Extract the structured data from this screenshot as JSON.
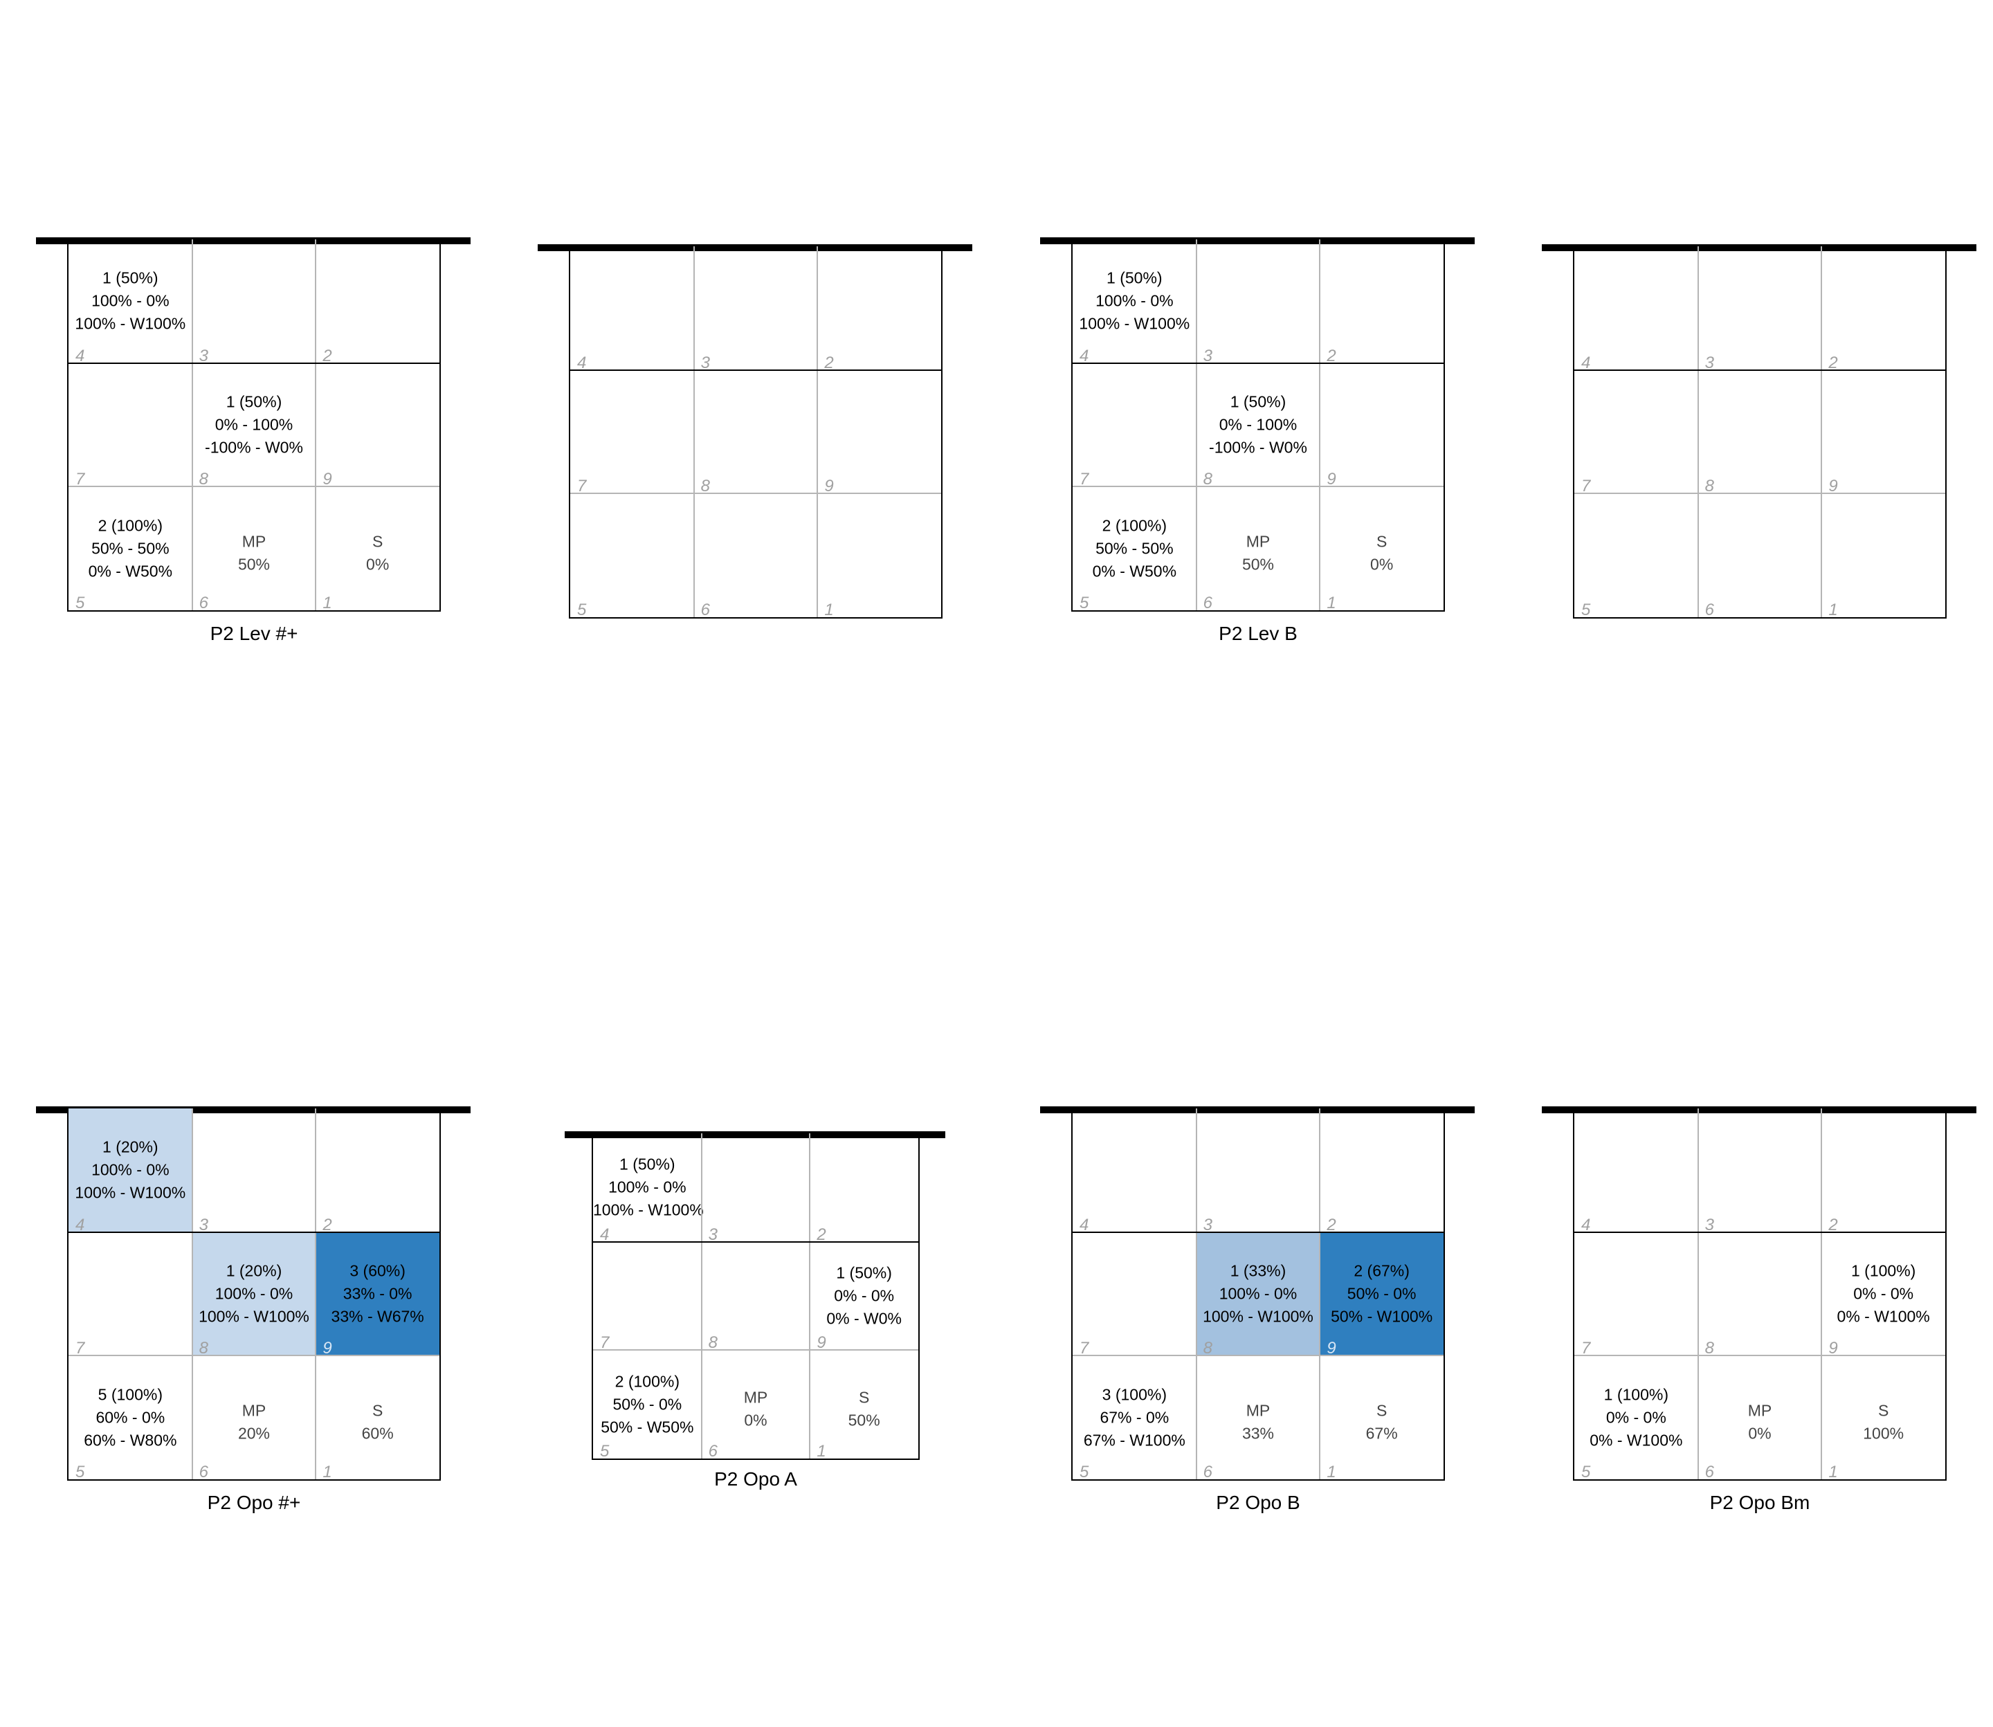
{
  "chart_data": [
    {
      "type": "table",
      "title": "P2 Lev #+",
      "cells": {
        "4": [
          "1 (50%)",
          "100% - 0%",
          "100% - W100%"
        ],
        "8": [
          "1 (50%)",
          "0% - 100%",
          "-100% - W0%"
        ],
        "5": [
          "2 (100%)",
          "50% - 50%",
          "0% - W50%"
        ],
        "6": [
          "MP",
          "50%"
        ],
        "1": [
          "S",
          "0%"
        ]
      },
      "highlights": {}
    },
    {
      "type": "table",
      "title": "",
      "cells": {},
      "highlights": {}
    },
    {
      "type": "table",
      "title": "P2 Lev B",
      "cells": {
        "4": [
          "1 (50%)",
          "100% - 0%",
          "100% - W100%"
        ],
        "8": [
          "1 (50%)",
          "0% - 100%",
          "-100% - W0%"
        ],
        "5": [
          "2 (100%)",
          "50% - 50%",
          "0% - W50%"
        ],
        "6": [
          "MP",
          "50%"
        ],
        "1": [
          "S",
          "0%"
        ]
      },
      "highlights": {}
    },
    {
      "type": "table",
      "title": "",
      "cells": {},
      "highlights": {}
    },
    {
      "type": "table",
      "title": "P2 Opo #+",
      "cells": {
        "4": [
          "1 (20%)",
          "100% - 0%",
          "100% - W100%"
        ],
        "8": [
          "1 (20%)",
          "100% - 0%",
          "100% - W100%"
        ],
        "9": [
          "3 (60%)",
          "33% - 0%",
          "33% - W67%"
        ],
        "5": [
          "5 (100%)",
          "60% - 0%",
          "60% - W80%"
        ],
        "6": [
          "MP",
          "20%"
        ],
        "1": [
          "S",
          "60%"
        ]
      },
      "highlights": {
        "4": "#c5d8ec",
        "8": "#c5d8ec",
        "9": "#2f7fbf"
      }
    },
    {
      "type": "table",
      "title": "P2 Opo A",
      "cells": {
        "4": [
          "1 (50%)",
          "100% - 0%",
          "100% - W100%"
        ],
        "9": [
          "1 (50%)",
          "0% - 0%",
          "0% - W0%"
        ],
        "5": [
          "2 (100%)",
          "50% - 0%",
          "50% - W50%"
        ],
        "6": [
          "MP",
          "0%"
        ],
        "1": [
          "S",
          "50%"
        ]
      },
      "highlights": {}
    },
    {
      "type": "table",
      "title": "P2 Opo B",
      "cells": {
        "8": [
          "1 (33%)",
          "100% - 0%",
          "100% - W100%"
        ],
        "9": [
          "2 (67%)",
          "50% - 0%",
          "50% - W100%"
        ],
        "5": [
          "3 (100%)",
          "67% - 0%",
          "67% - W100%"
        ],
        "6": [
          "MP",
          "33%"
        ],
        "1": [
          "S",
          "67%"
        ]
      },
      "highlights": {
        "8": "#a3c1df",
        "9": "#2f7fbf"
      }
    },
    {
      "type": "table",
      "title": "P2 Opo Bm",
      "cells": {
        "9": [
          "1 (100%)",
          "0% - 0%",
          "0% - W100%"
        ],
        "5": [
          "1 (100%)",
          "0% - 0%",
          "0% - W100%"
        ],
        "6": [
          "MP",
          "0%"
        ],
        "1": [
          "S",
          "100%"
        ]
      },
      "highlights": {}
    }
  ]
}
